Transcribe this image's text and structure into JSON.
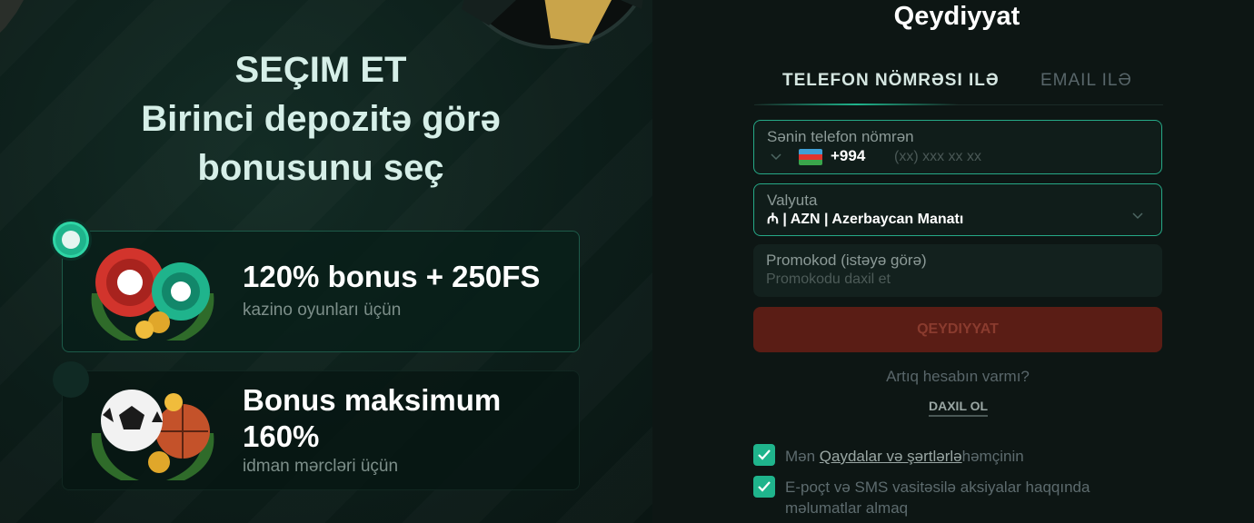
{
  "promo": {
    "heading_line1": "SEÇIM ET",
    "heading_line2": "Birinci depozitə görə",
    "heading_line3": "bonusunu seç",
    "bonuses": [
      {
        "title": "120% bonus + 250FS",
        "subtitle": "kazino oyunları üçün",
        "selected": true,
        "icon": "casino-chips-icon"
      },
      {
        "title": "Bonus maksimum 160%",
        "subtitle": "idman mərcləri üçün",
        "selected": false,
        "icon": "sports-ball-icon"
      }
    ]
  },
  "form": {
    "title": "Qeydiyyat",
    "tabs": [
      {
        "label": "TELEFON NÖMRƏSI ILƏ",
        "active": true
      },
      {
        "label": "EMAIL ILƏ",
        "active": false
      }
    ],
    "phone": {
      "label": "Sənin telefon nömrən",
      "dial_code": "+994",
      "placeholder": "(xx) xxx xx xx"
    },
    "currency": {
      "label": "Valyuta",
      "value": "₼ | AZN | Azerbaycan Manatı"
    },
    "promo": {
      "label": "Promokod (istəyə görə)",
      "placeholder": "Promokodu daxil et"
    },
    "submit_label": "QEYDIYYAT",
    "have_account": "Artıq hesabın varmı?",
    "login_label": "DAXIL OL",
    "checkbox1": {
      "prefix": "Mən ",
      "link": "Qaydalar və şərtlərlə",
      "suffix": "həmçinin",
      "checked": true
    },
    "checkbox2": {
      "text": "E-poçt və SMS vasitəsilə aksiyalar haqqında məlumatlar almaq",
      "checked": true
    }
  },
  "colors": {
    "accent": "#1fb48c",
    "submit_bg": "#5a1d15",
    "background": "#0d1614"
  }
}
